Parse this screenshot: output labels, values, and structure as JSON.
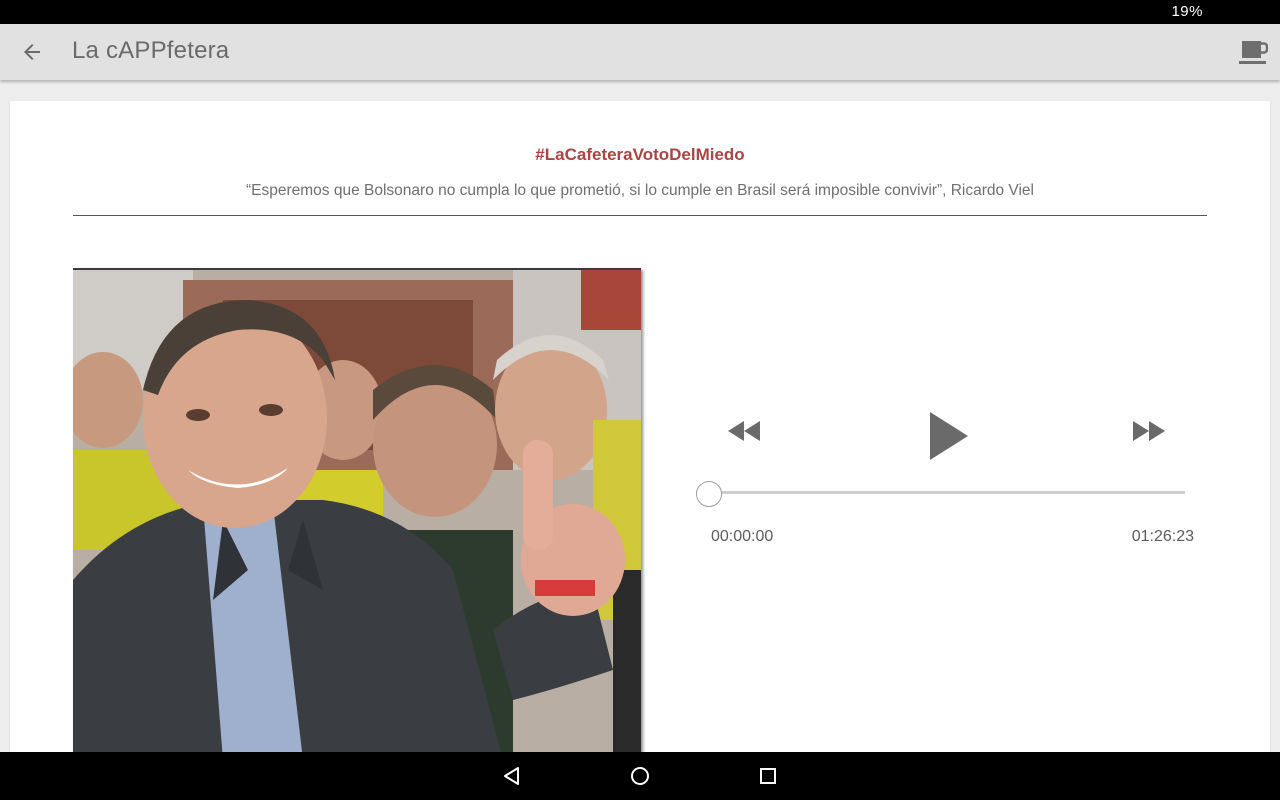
{
  "status_bar": {
    "battery": "19%"
  },
  "app_bar": {
    "title": "La cAPPfetera"
  },
  "episode": {
    "hashtag": "#LaCafeteraVotoDelMiedo",
    "quote": "“Esperemos que Bolsonaro no cumpla lo que prometió, si lo cumple en Brasil será imposible convivir”, Ricardo Viel"
  },
  "player": {
    "current_time": "00:00:00",
    "total_time": "01:26:23",
    "progress": 0
  },
  "icons": {
    "back": "arrow-back-icon",
    "coffee": "coffee-cup-icon",
    "rewind": "rewind-icon",
    "play": "play-icon",
    "fast_forward": "fast-forward-icon",
    "nav_back": "nav-back-icon",
    "nav_home": "nav-home-icon",
    "nav_recents": "nav-recents-icon"
  },
  "colors": {
    "accent": "#a84646",
    "app_bar": "#e1e1e1",
    "background": "#eeeeee"
  }
}
